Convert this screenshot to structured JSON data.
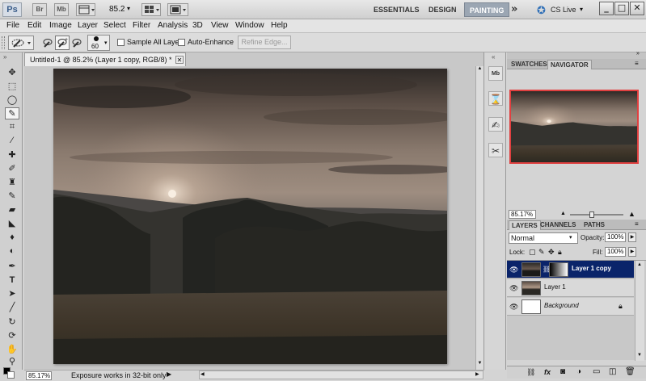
{
  "appbar": {
    "logo": "Ps",
    "bridge": "Br",
    "minibridge": "Mb",
    "zoom_value": "85.2",
    "workspaces": [
      "ESSENTIALS",
      "DESIGN",
      "PAINTING"
    ],
    "active_workspace": "PAINTING",
    "overflow": "»",
    "cs_live": "CS Live",
    "window_minimize": "_",
    "window_restore": "□",
    "window_close": "✕"
  },
  "menubar": [
    "File",
    "Edit",
    "Image",
    "Layer",
    "Select",
    "Filter",
    "Analysis",
    "3D",
    "View",
    "Window",
    "Help"
  ],
  "options": {
    "brush_size": "60",
    "sample_all_layers": "Sample All Layers",
    "auto_enhance": "Auto-Enhance",
    "refine_edge": "Refine Edge..."
  },
  "document": {
    "tab_title": "Untitled-1 @ 85.2% (Layer 1 copy, RGB/8) *",
    "tab_close": "✕"
  },
  "status": {
    "zoom": "85.17%",
    "message": "Exposure works in 32-bit only"
  },
  "navigator": {
    "tabs": [
      "SWATCHES",
      "NAVIGATOR"
    ],
    "active_tab": "NAVIGATOR",
    "zoom": "85.17%"
  },
  "layers_panel": {
    "tabs": [
      "LAYERS",
      "CHANNELS",
      "PATHS"
    ],
    "active_tab": "LAYERS",
    "blend_mode": "Normal",
    "opacity_label": "Opacity:",
    "opacity_value": "100%",
    "lock_label": "Lock:",
    "fill_label": "Fill:",
    "fill_value": "100%",
    "layers": [
      {
        "name": "Layer 1 copy",
        "selected": true
      },
      {
        "name": "Layer 1",
        "selected": false
      },
      {
        "name": "Background",
        "selected": false
      }
    ],
    "footer_icons": [
      "link-icon",
      "fx-icon",
      "mask-icon",
      "adjustment-icon",
      "group-icon",
      "new-layer-icon",
      "trash-icon"
    ]
  },
  "colors": {
    "accent_selected": "#0a246a",
    "navigator_frame": "#e04040",
    "workspace_active": "#9ba6b3"
  }
}
